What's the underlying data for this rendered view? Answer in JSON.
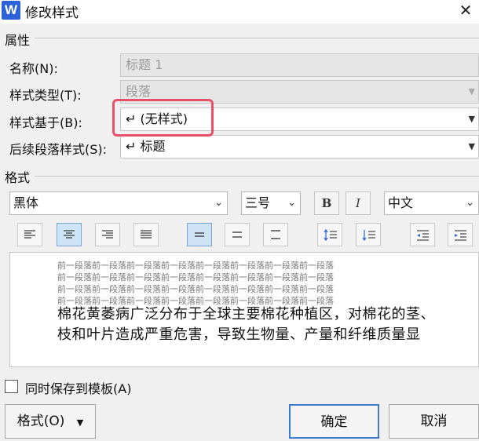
{
  "window": {
    "title": "修改样式",
    "app_icon_letter": "W",
    "close_symbol": "✕"
  },
  "properties": {
    "group_label": "属性",
    "name_label": "名称(N):",
    "name_value": "标题 1",
    "style_type_label": "样式类型(T):",
    "style_type_value": "段落",
    "based_on_label": "样式基于(B):",
    "based_on_value": "↵ (无样式)",
    "following_label": "后续段落样式(S):",
    "following_value": "↵ 标题"
  },
  "format": {
    "group_label": "格式",
    "font": "黑体",
    "size": "三号",
    "bold": "B",
    "italic": "I",
    "language": "中文"
  },
  "preview": {
    "sample_lines": [
      "前一段落前一段落前一段落前一段落前一段落前一段落前一段落前一段落",
      "前一段落前一段落前一段落前一段落前一段落前一段落前一段落前一段落",
      "前一段落前一段落前一段落前一段落前一段落前一段落前一段落前一段落",
      "前一段落前一段落前一段落前一段落前一段落前一段落前一段落前一段落"
    ],
    "text_line1": "棉花黄萎病广泛分布于全球主要棉花种植区，对棉花的茎、",
    "text_line2": "枝和叶片造成严重危害，导致生物量、产量和纤维质量显"
  },
  "save_to_template": {
    "label": "同时保存到模板(A)",
    "checked": false
  },
  "buttons": {
    "format": "格式(O)",
    "ok": "确定",
    "cancel": "取消"
  },
  "colors": {
    "highlight": "#e8506a",
    "active_button": "#cfe3f7",
    "primary_border": "#3d7bd1"
  }
}
